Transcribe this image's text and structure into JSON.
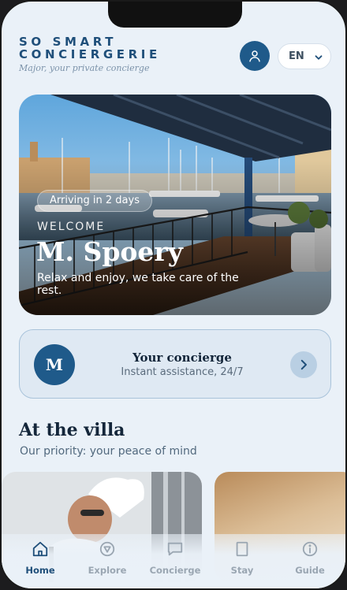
{
  "brand": {
    "line1": "SO SMART",
    "line2": "CONCIERGERIE",
    "tagline": "Major, your private concierge"
  },
  "header": {
    "language": "EN",
    "user_icon": "user-icon",
    "chevron_icon": "chevron-down-icon"
  },
  "hero": {
    "badge": "Arriving in 2 days",
    "eyebrow": "WELCOME",
    "guest_name": "M. Spoery",
    "subtitle": "Relax and enjoy, we take care of the rest."
  },
  "concierge": {
    "initial": "M",
    "title": "Your concierge",
    "subtitle": "Instant assistance, 24/7",
    "arrow_icon": "chevron-right-icon"
  },
  "villa": {
    "title": "At the villa",
    "subtitle": "Our priority: your peace of mind"
  },
  "nav": {
    "items": [
      {
        "label": "Home",
        "icon": "home-icon",
        "active": true
      },
      {
        "label": "Explore",
        "icon": "compass-icon",
        "active": false
      },
      {
        "label": "Concierge",
        "icon": "chat-icon",
        "active": false
      },
      {
        "label": "Stay",
        "icon": "door-icon",
        "active": false
      },
      {
        "label": "Guide",
        "icon": "info-icon",
        "active": false
      }
    ]
  },
  "colors": {
    "primary": "#1f5a8a",
    "background": "#eaf1f8",
    "text_dark": "#14263a",
    "nav_inactive": "#9aa6b2"
  }
}
